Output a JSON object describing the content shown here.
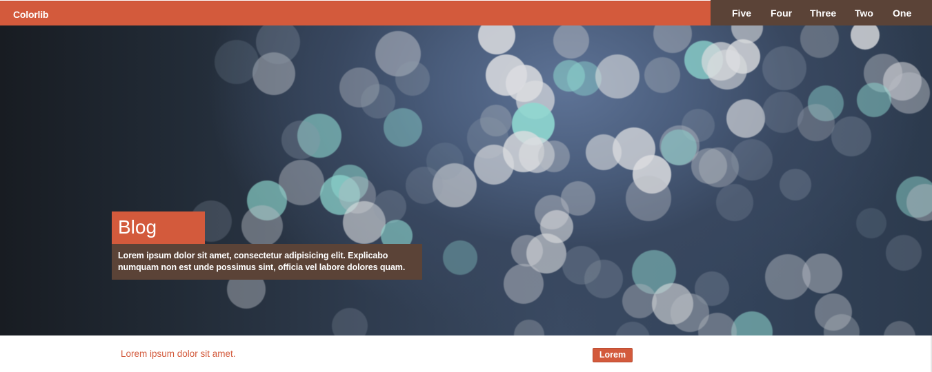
{
  "header": {
    "brand": "Colorlib",
    "nav": [
      "Five",
      "Four",
      "Three",
      "Two",
      "One"
    ]
  },
  "hero": {
    "title": "Blog",
    "description": "Lorem ipsum dolor sit amet, consectetur adipisicing elit. Explicabo numquam non est unde possimus sint, officia vel labore dolores quam."
  },
  "strip": {
    "text": "Lorem ipsum dolor sit amet.",
    "button": "Lorem"
  },
  "colors": {
    "accent": "#d35a3c",
    "dark_brown": "#5b4337"
  }
}
